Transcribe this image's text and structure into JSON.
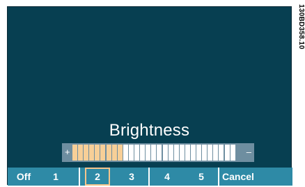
{
  "side_code": "130BD358.10",
  "dialog": {
    "title": "Brightness"
  },
  "slider": {
    "plus_label": "+",
    "minus_label": "–",
    "segments_total": 29,
    "segments_filled": 9,
    "filled_color": "#f7cf97",
    "empty_color": "#ffffff"
  },
  "buttons": [
    {
      "label": "Off",
      "selected": false
    },
    {
      "label": "1",
      "selected": false
    },
    {
      "label": "2",
      "selected": true
    },
    {
      "label": "3",
      "selected": false
    },
    {
      "label": "4",
      "selected": false
    },
    {
      "label": "5",
      "selected": false
    },
    {
      "label": "Cancel",
      "selected": false
    }
  ]
}
